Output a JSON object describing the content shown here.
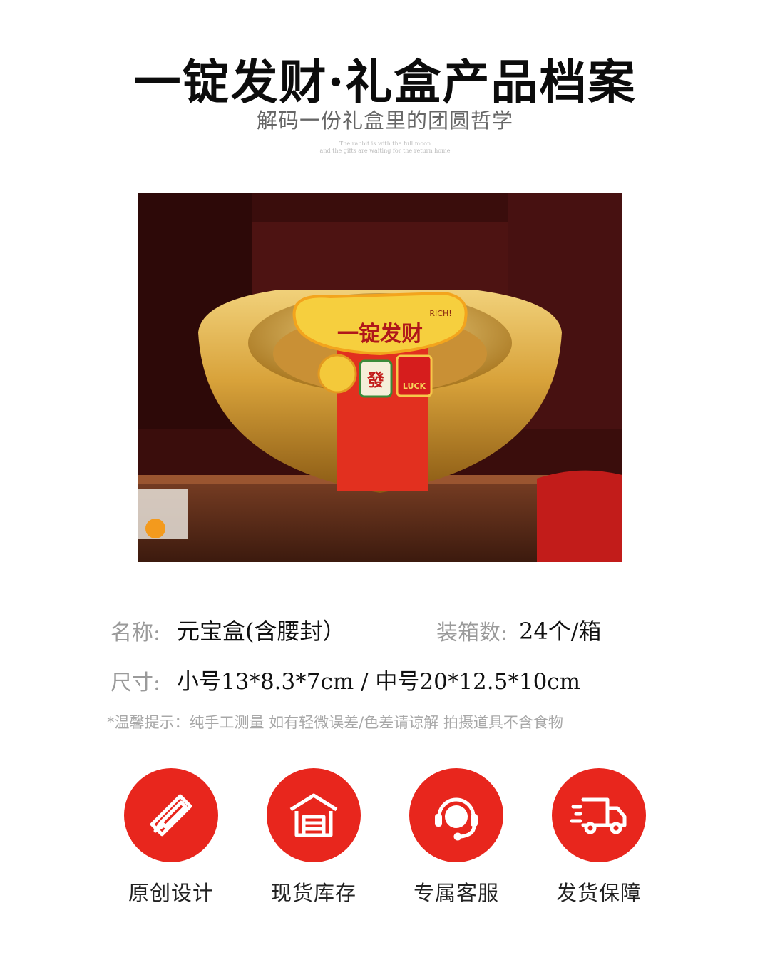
{
  "header": {
    "title": "一锭发财·礼盒产品档案",
    "subtitle": "解码一份礼盒里的团圆哲学",
    "english_line_1": "The rabbit is with the full moon",
    "english_line_2": "and the gifts are waiting for the return home"
  },
  "product_image": {
    "band_text": "一锭发财",
    "band_small_text": "RICH!",
    "tile_char": "發",
    "envelope_text": "LUCK"
  },
  "specs": {
    "name_label": "名称:",
    "name_value": "元宝盒(含腰封）",
    "box_count_label": "装箱数:",
    "box_count_value": "24个/箱",
    "size_label": "尺寸:",
    "size_value": "小号13*8.3*7cm / 中号20*12.5*10cm",
    "note": "*温馨提示：纯手工测量 如有轻微误差/色差请谅解 拍摄道具不含食物"
  },
  "features": [
    {
      "label": "原创设计",
      "icon": "ruler-pencil-icon"
    },
    {
      "label": "现货库存",
      "icon": "warehouse-icon"
    },
    {
      "label": "专属客服",
      "icon": "headset-icon"
    },
    {
      "label": "发货保障",
      "icon": "delivery-truck-icon"
    }
  ],
  "colors": {
    "accent_red": "#e8261d",
    "gold": "#d8a23a"
  }
}
